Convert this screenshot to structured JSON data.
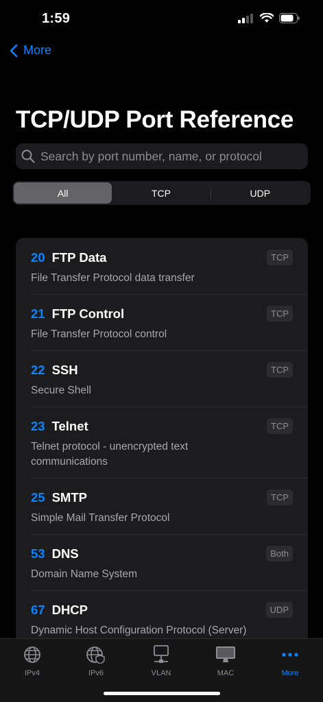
{
  "status": {
    "time": "1:59"
  },
  "nav": {
    "back_label": "More"
  },
  "page": {
    "title": "TCP/UDP Port Reference"
  },
  "search": {
    "placeholder": "Search by port number, name, or protocol"
  },
  "filter": {
    "segments": [
      "All",
      "TCP",
      "UDP"
    ],
    "selected": "All"
  },
  "ports": [
    {
      "port": "20",
      "name": "FTP Data",
      "description": "File Transfer Protocol data transfer",
      "protocol": "TCP"
    },
    {
      "port": "21",
      "name": "FTP Control",
      "description": "File Transfer Protocol control",
      "protocol": "TCP"
    },
    {
      "port": "22",
      "name": "SSH",
      "description": "Secure Shell",
      "protocol": "TCP"
    },
    {
      "port": "23",
      "name": "Telnet",
      "description": "Telnet protocol - unencrypted text communications",
      "protocol": "TCP"
    },
    {
      "port": "25",
      "name": "SMTP",
      "description": "Simple Mail Transfer Protocol",
      "protocol": "TCP"
    },
    {
      "port": "53",
      "name": "DNS",
      "description": "Domain Name System",
      "protocol": "Both"
    },
    {
      "port": "67",
      "name": "DHCP",
      "description": "Dynamic Host Configuration Protocol (Server)",
      "protocol": "UDP"
    }
  ],
  "tabs": [
    {
      "label": "IPv4",
      "icon": "globe-icon"
    },
    {
      "label": "IPv6",
      "icon": "globe-shield-icon"
    },
    {
      "label": "VLAN",
      "icon": "network-monitor-icon"
    },
    {
      "label": "MAC",
      "icon": "desktop-icon"
    },
    {
      "label": "More",
      "icon": "more-dots-icon"
    }
  ],
  "colors": {
    "accent": "#0a84ff",
    "background": "#000000",
    "card": "#1c1c1e"
  }
}
